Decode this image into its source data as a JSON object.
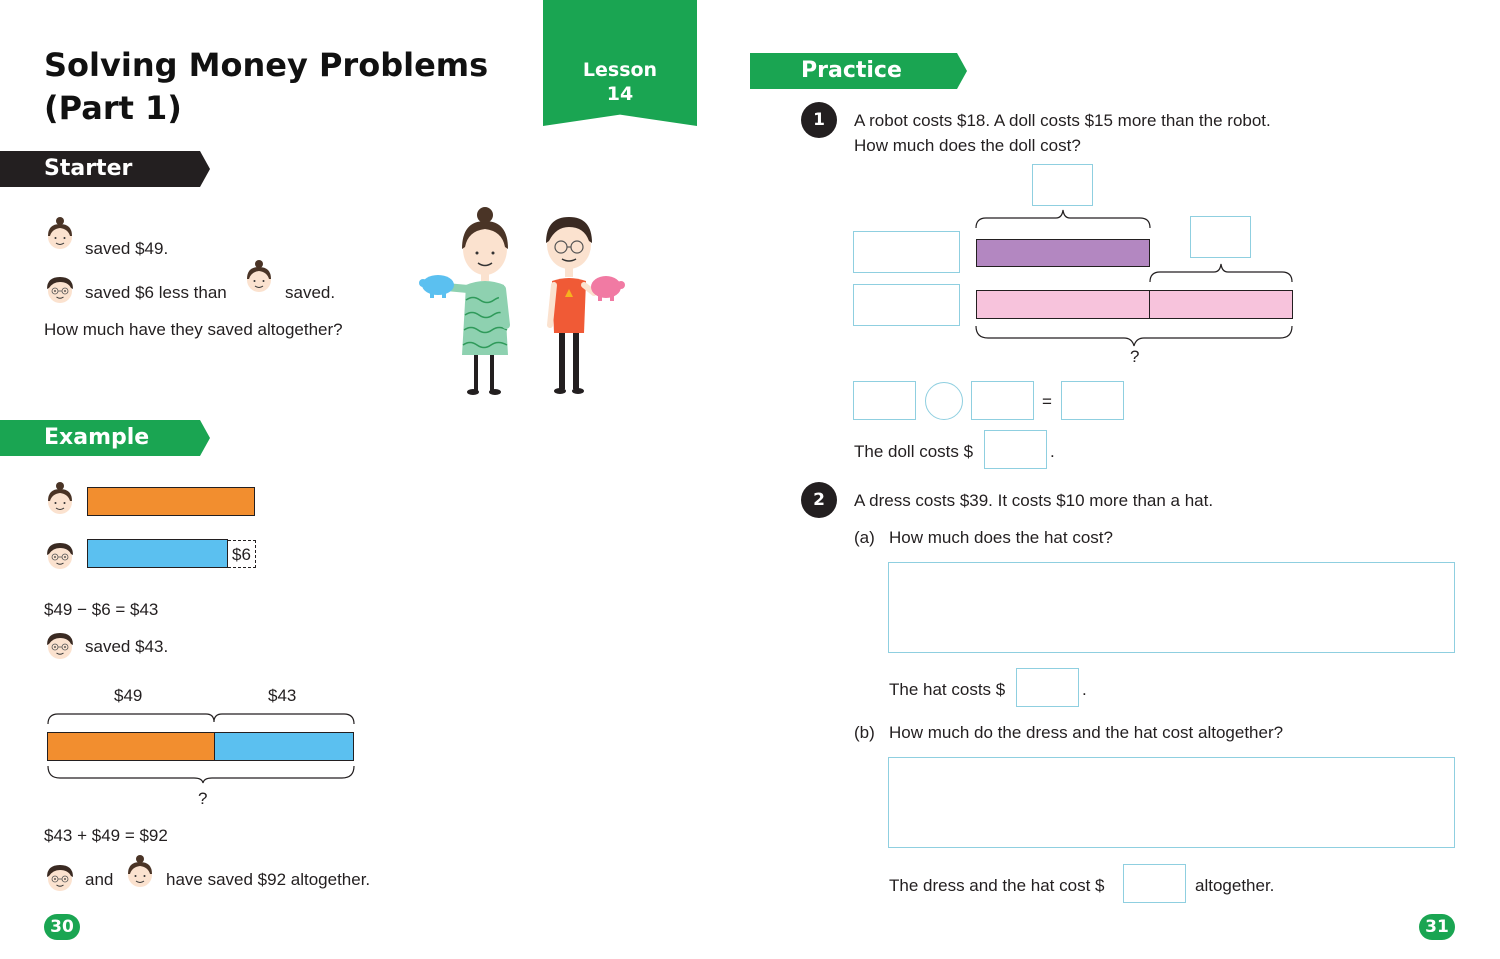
{
  "title": {
    "line1": "Solving Money Problems",
    "line2": "(Part 1)"
  },
  "lesson": {
    "label": "Lesson",
    "number": "14"
  },
  "starter": {
    "heading": "Starter",
    "line1": "saved $49.",
    "line2a": "saved $6 less than",
    "line2b": "saved.",
    "question": "How much have they saved altogether?"
  },
  "example": {
    "heading": "Example",
    "bar_label_6": "$6",
    "calc1": "$49 − $6 = $43",
    "saved43": "saved $43.",
    "label_49": "$49",
    "label_43": "$43",
    "question_mark": "?",
    "calc2": "$43 + $49  = $92",
    "and": "and",
    "conclusion": "have saved $92 altogether."
  },
  "practice": {
    "heading": "Practice",
    "q1": {
      "number": "1",
      "line1": "A robot costs $18. A doll costs $15 more than the robot.",
      "line2": "How much does the doll cost?",
      "question_mark": "?",
      "equals": "=",
      "answer_prefix": "The doll costs $",
      "answer_suffix": "."
    },
    "q2": {
      "number": "2",
      "text": "A dress costs $39. It costs $10 more than a hat.",
      "a_label": "(a)",
      "a_question": "How much does the hat cost?",
      "a_answer_prefix": "The hat costs $",
      "a_answer_suffix": ".",
      "b_label": "(b)",
      "b_question": "How much do the dress and the hat cost altogether?",
      "b_answer_prefix": "The dress and the hat cost $",
      "b_answer_suffix": "altogether."
    }
  },
  "page_numbers": {
    "left": "30",
    "right": "31"
  },
  "colors": {
    "green": "#1aa552",
    "dark": "#231f20",
    "orange": "#f28e2f",
    "blue": "#5bc0f0",
    "purple": "#b387c1",
    "pink": "#f7c3dc",
    "box_outline": "#8fcfe0"
  }
}
